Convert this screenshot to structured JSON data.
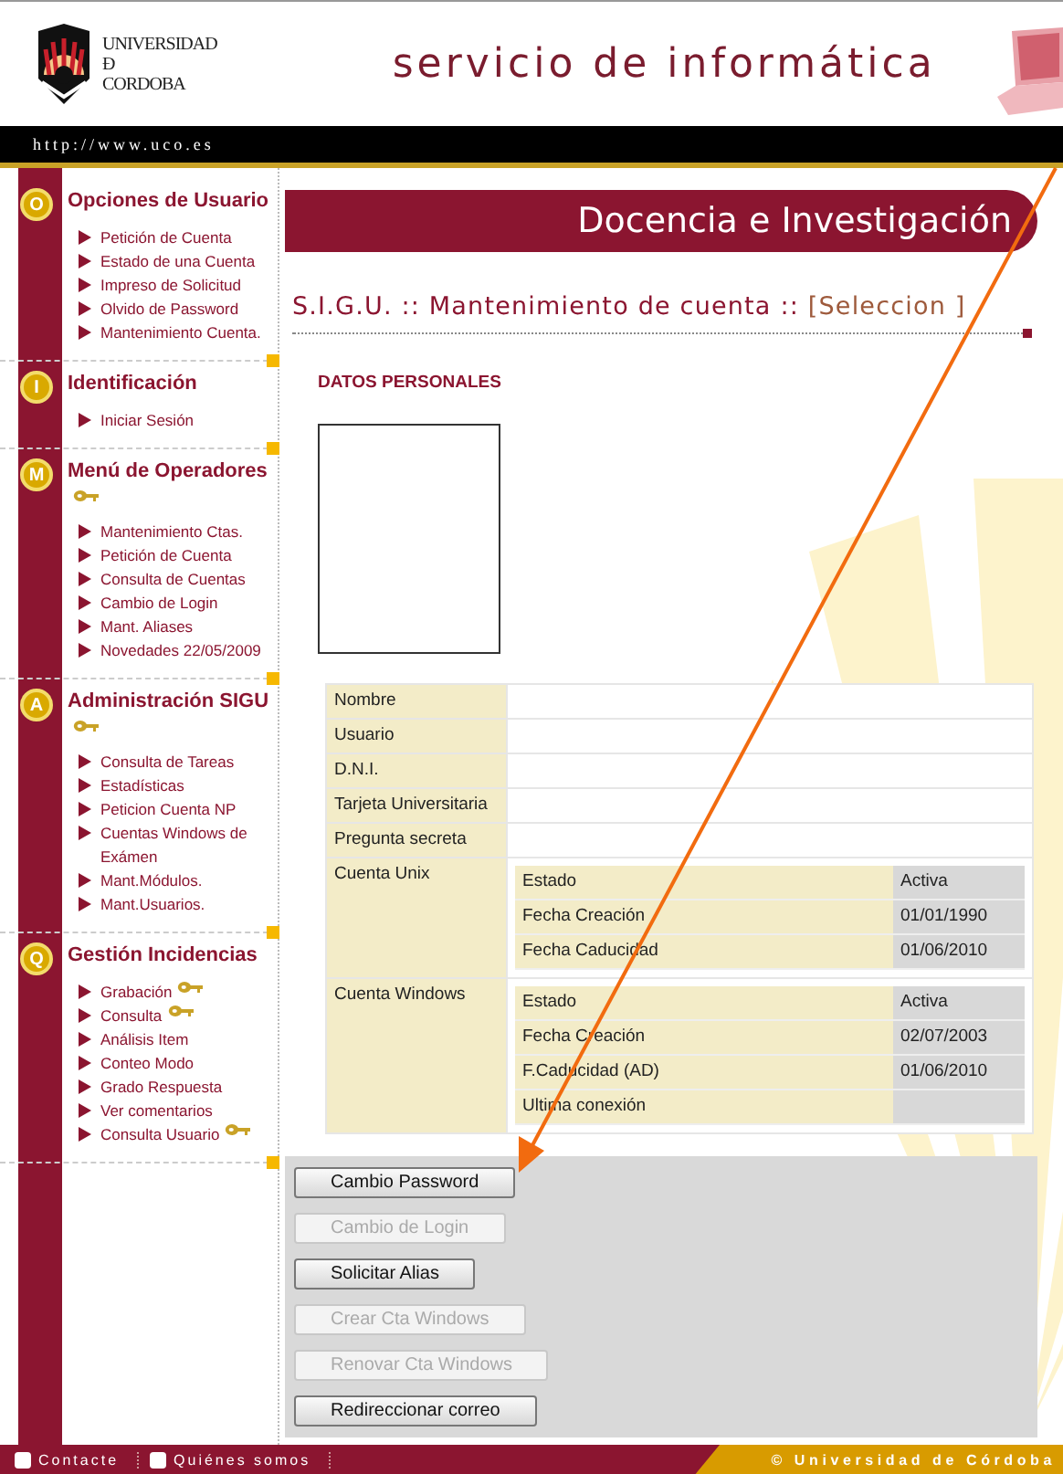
{
  "header": {
    "logo_text": [
      "UNIVERSIDAD",
      "Đ",
      "CORDOBA"
    ],
    "title": "servicio de informática",
    "url": "http://www.uco.es"
  },
  "sidebar": {
    "sections": [
      {
        "letter": "O",
        "title": "Opciones de Usuario",
        "key": false,
        "items": [
          {
            "label": "Petición de Cuenta",
            "key": false
          },
          {
            "label": "Estado de una Cuenta",
            "key": false
          },
          {
            "label": "Impreso de Solicitud",
            "key": false
          },
          {
            "label": "Olvido de Password",
            "key": false
          },
          {
            "label": "Mantenimiento Cuenta.",
            "key": false
          }
        ]
      },
      {
        "letter": "I",
        "title": "Identificación",
        "key": false,
        "items": [
          {
            "label": "Iniciar Sesión",
            "key": false
          }
        ]
      },
      {
        "letter": "M",
        "title": "Menú de Operadores",
        "key": true,
        "items": [
          {
            "label": "Mantenimiento Ctas.",
            "key": false
          },
          {
            "label": "Petición de Cuenta",
            "key": false
          },
          {
            "label": "Consulta de Cuentas",
            "key": false
          },
          {
            "label": "Cambio de Login",
            "key": false
          },
          {
            "label": "Mant. Aliases",
            "key": false
          },
          {
            "label": "Novedades 22/05/2009",
            "key": false
          }
        ]
      },
      {
        "letter": "A",
        "title": "Administración SIGU",
        "key": true,
        "items": [
          {
            "label": "Consulta de Tareas",
            "key": false
          },
          {
            "label": "Estadísticas",
            "key": false
          },
          {
            "label": "Peticion Cuenta NP",
            "key": false
          },
          {
            "label": "Cuentas Windows de Exámen",
            "key": false
          },
          {
            "label": "Mant.Módulos.",
            "key": false
          },
          {
            "label": "Mant.Usuarios.",
            "key": false
          }
        ]
      },
      {
        "letter": "Q",
        "title": "Gestión Incidencias",
        "key": false,
        "items": [
          {
            "label": "Grabación",
            "key": true
          },
          {
            "label": "Consulta",
            "key": true
          },
          {
            "label": "Análisis Item",
            "key": false
          },
          {
            "label": "Conteo Modo",
            "key": false
          },
          {
            "label": "Grado Respuesta",
            "key": false
          },
          {
            "label": "Ver comentarios",
            "key": false
          },
          {
            "label": "Consulta Usuario",
            "key": true
          }
        ]
      }
    ]
  },
  "main": {
    "banner": "Docencia e Investigación",
    "heading": {
      "title": "S.I.G.U. :: Mantenimiento de cuenta :: ",
      "mode": "[Seleccion ]"
    },
    "section": "DATOS PERSONALES",
    "rows": [
      {
        "label": "Nombre"
      },
      {
        "label": "Usuario"
      },
      {
        "label": "D.N.I."
      },
      {
        "label": "Tarjeta Universitaria"
      },
      {
        "label": "Pregunta secreta"
      },
      {
        "label": "Cuenta Unix",
        "fields": [
          {
            "label": "Estado",
            "value": "Activa"
          },
          {
            "label": "Fecha Creación",
            "value": "01/01/1990"
          },
          {
            "label": "Fecha Caducidad",
            "value": "01/06/2010"
          }
        ]
      },
      {
        "label": "Cuenta Windows",
        "fields": [
          {
            "label": "Estado",
            "value": "Activa"
          },
          {
            "label": "Fecha Creación",
            "value": "02/07/2003"
          },
          {
            "label": "F.Caducidad (AD)",
            "value": "01/06/2010"
          },
          {
            "label": "Ultima conexión"
          }
        ]
      }
    ],
    "buttons": [
      {
        "label": "Cambio Password",
        "disabled": false
      },
      {
        "label": "Cambio de Login",
        "disabled": true
      },
      {
        "label": "Solicitar Alias",
        "disabled": false
      },
      {
        "label": "Crear Cta Windows",
        "disabled": true
      },
      {
        "label": "Renovar Cta Windows",
        "disabled": true
      },
      {
        "label": "Redireccionar correo",
        "disabled": false
      }
    ]
  },
  "footer": {
    "links": [
      "Contacte",
      "Quiénes somos"
    ],
    "copyright": "© Universidad de Córdoba"
  }
}
